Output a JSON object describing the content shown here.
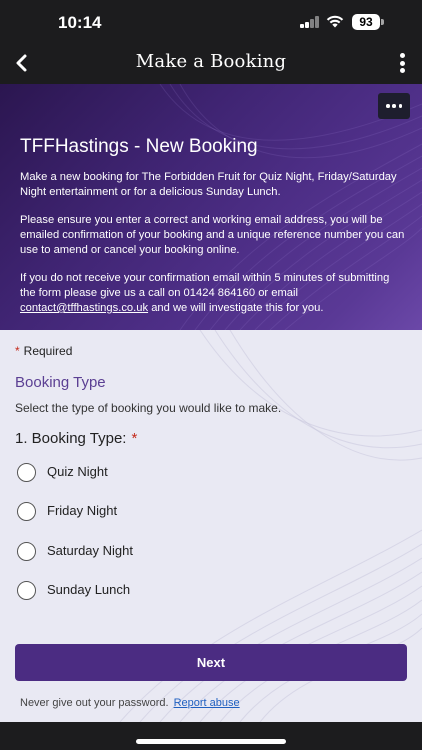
{
  "status": {
    "time": "10:14",
    "battery": "93"
  },
  "nav": {
    "title": "Make a Booking",
    "back_icon": "chevron-left-icon",
    "menu_icon": "kebab-icon"
  },
  "banner": {
    "more_icon": "ellipsis-icon",
    "title": "TFFHastings - New Booking",
    "para1": "Make a new booking for The Forbidden Fruit for Quiz Night, Friday/Saturday Night entertainment or for a delicious Sunday Lunch.",
    "para2": "Please ensure you enter a correct and working email address, you will be emailed confirmation of your booking and a unique reference number you can use to amend or cancel your booking online.",
    "para3_pre": "If you do not receive your confirmation email within 5 minutes of submitting the form please give us a call on 01424 864160 or email",
    "para3_link": "contact@tffhastings.co.uk",
    "para3_post": "and we will investigate this for you."
  },
  "form": {
    "required_star": "*",
    "required_label": "Required",
    "section_title": "Booking Type",
    "section_desc": "Select the type of booking you would like to make.",
    "question": "1. Booking Type:",
    "options": [
      {
        "label": "Quiz Night",
        "selected": false
      },
      {
        "label": "Friday Night",
        "selected": false
      },
      {
        "label": "Saturday Night",
        "selected": false
      },
      {
        "label": "Sunday Lunch",
        "selected": false
      }
    ],
    "next_label": "Next",
    "footer_text": "Never give out your password.",
    "report_link": "Report abuse"
  },
  "colors": {
    "accent": "#4b2c82",
    "section_title": "#5b3f93",
    "required": "#c42b1c",
    "link": "#2060c0"
  }
}
